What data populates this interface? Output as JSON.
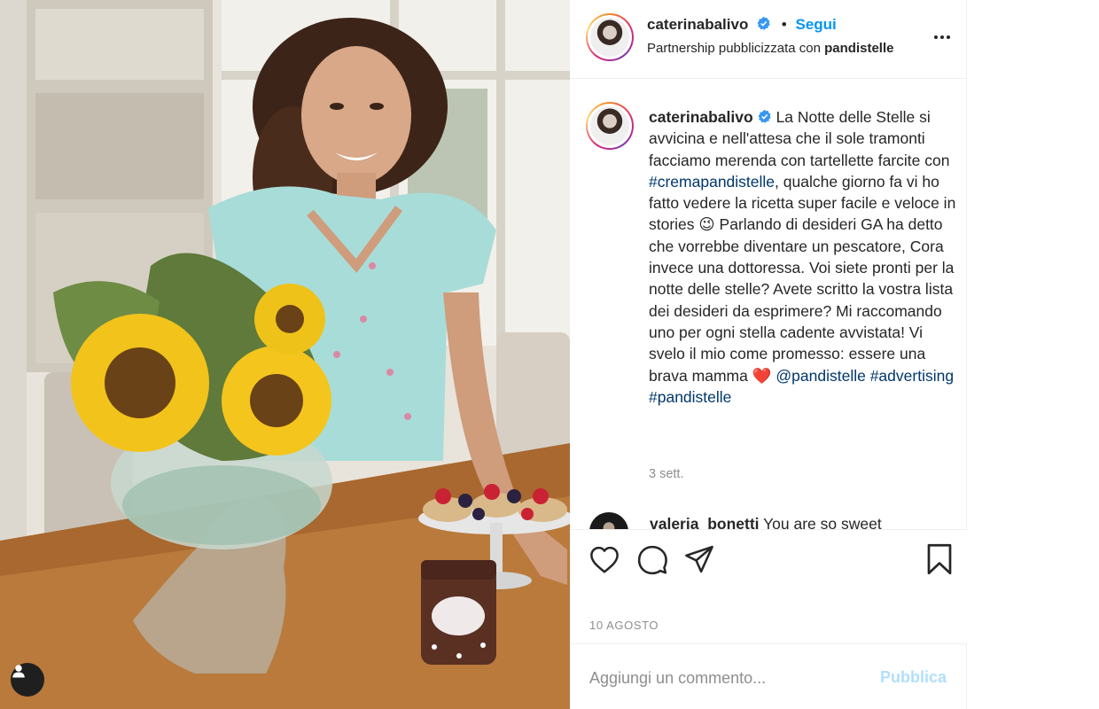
{
  "post": {
    "username": "caterinabalivo",
    "follow_label": "Segui",
    "separator": "•",
    "partnership_prefix": "Partnership pubblicizzata con",
    "partner_name": "pandistelle",
    "caption_parts": {
      "p1": "La Notte delle Stelle si avvicina e nell'attesa che il sole tramonti facciamo merenda con tartellette farcite con",
      "hashtag1": "#cremapandistelle",
      "p2": ", qualche giorno fa vi ho fatto vedere la ricetta super facile e veloce in stories",
      "emoji_wink": "😉",
      "p3": "Parlando di desideri GA ha detto che vorrebbe diventare un pescatore, Cora invece una dottoressa. Voi siete pronti per la notte delle stelle? Avete scritto la vostra lista dei desideri da esprimere? Mi raccomando uno per ogni stella cadente avvistata! Vi svelo il mio come promesso: essere una brava mamma",
      "emoji_heart": "❤️",
      "mention": "@pandistelle",
      "hashtag2": "#advertising",
      "hashtag3": "#pandistelle"
    },
    "caption_time": "3 sett.",
    "comment_preview": {
      "username": "valeria_bonetti",
      "text": "You are so sweet"
    },
    "date_label": "10 AGOSTO",
    "comment_placeholder": "Aggiungi un commento...",
    "publish_label": "Pubblica"
  },
  "icons": {
    "like": "heart-icon",
    "comment": "comment-bubble-icon",
    "share": "paper-plane-icon",
    "save": "bookmark-icon",
    "more": "more-dots-icon",
    "verified": "verified-badge-icon",
    "tag": "person-icon"
  },
  "colors": {
    "accent": "#0095f6",
    "hashtag": "#00376b",
    "muted": "#8e8e8e",
    "publish_disabled": "#b2dffc",
    "text": "#262626"
  }
}
